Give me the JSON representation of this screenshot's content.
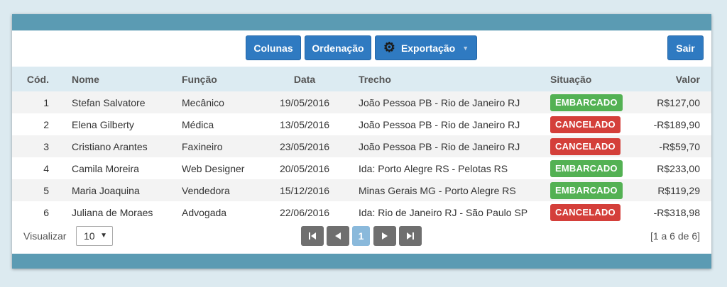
{
  "toolbar": {
    "colunas": "Colunas",
    "ordenacao": "Ordenação",
    "exportacao": "Exportação",
    "sair": "Sair",
    "export_icon": "gear-icon",
    "caret_icon": "caret-down-icon"
  },
  "table": {
    "headers": [
      "Cód.",
      "Nome",
      "Função",
      "Data",
      "Trecho",
      "Situação",
      "Valor"
    ],
    "rows": [
      {
        "cod": "1",
        "nome": "Stefan Salvatore",
        "funcao": "Mecânico",
        "data": "19/05/2016",
        "trecho": "João Pessoa PB - Rio de Janeiro RJ",
        "situacao": "EMBARCADO",
        "valor": "R$127,00"
      },
      {
        "cod": "2",
        "nome": "Elena Gilberty",
        "funcao": "Médica",
        "data": "13/05/2016",
        "trecho": "João Pessoa PB - Rio de Janeiro RJ",
        "situacao": "CANCELADO",
        "valor": "-R$189,90"
      },
      {
        "cod": "3",
        "nome": "Cristiano Arantes",
        "funcao": "Faxineiro",
        "data": "23/05/2016",
        "trecho": "João Pessoa PB - Rio de Janeiro RJ",
        "situacao": "CANCELADO",
        "valor": "-R$59,70"
      },
      {
        "cod": "4",
        "nome": "Camila Moreira",
        "funcao": "Web Designer",
        "data": "20/05/2016",
        "trecho": "Ida: Porto Alegre RS - Pelotas RS",
        "situacao": "EMBARCADO",
        "valor": "R$233,00"
      },
      {
        "cod": "5",
        "nome": "Maria Joaquina",
        "funcao": "Vendedora",
        "data": "15/12/2016",
        "trecho": "Minas Gerais MG - Porto Alegre RS",
        "situacao": "EMBARCADO",
        "valor": "R$119,29"
      },
      {
        "cod": "6",
        "nome": "Juliana de Moraes",
        "funcao": "Advogada",
        "data": "22/06/2016",
        "trecho": "Ida: Rio de Janeiro RJ - São Paulo SP",
        "situacao": "CANCELADO",
        "valor": "-R$318,98"
      }
    ]
  },
  "status_colors": {
    "EMBARCADO": "#53b153",
    "CANCELADO": "#d43f3a"
  },
  "footer": {
    "visualizar_label": "Visualizar",
    "page_size": "10",
    "current_page": "1",
    "range": "[1 a 6 de 6]"
  },
  "colors": {
    "accent": "#2f7ac1",
    "band": "#5b9bb3",
    "header_bg": "#dcebf2"
  }
}
